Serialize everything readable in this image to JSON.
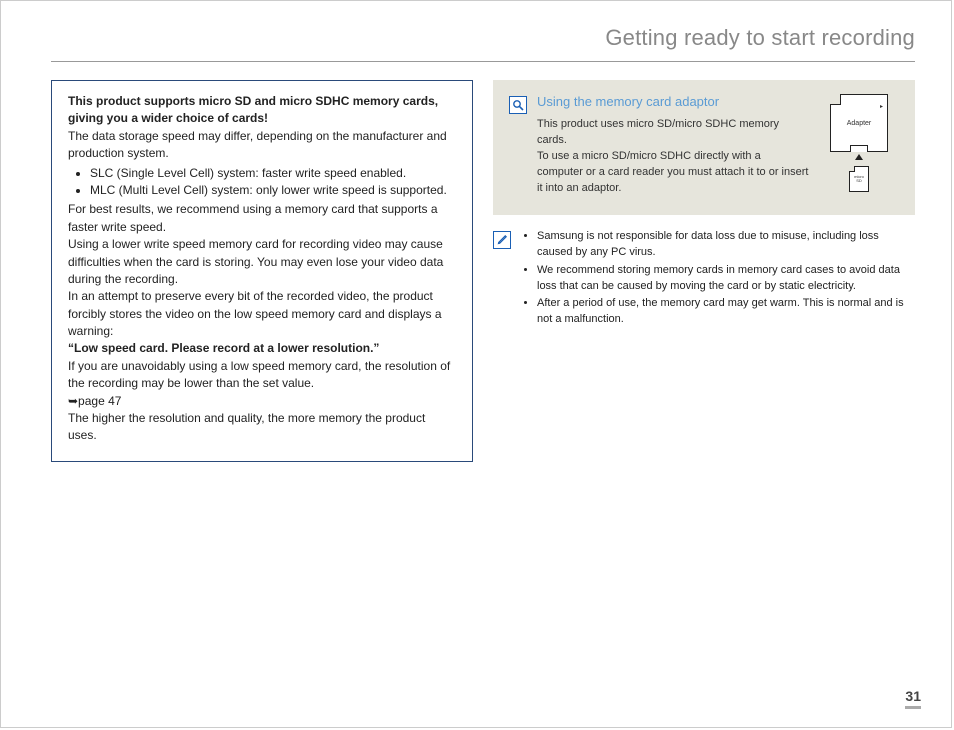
{
  "header": {
    "title": "Getting ready to start recording"
  },
  "left": {
    "lead_bold": "This product supports micro SD and micro SDHC memory cards, giving you a wider choice of cards!",
    "p1": "The data storage speed may differ, depending on the manufacturer and production system.",
    "bullets": [
      "SLC (Single Level Cell) system: faster write speed enabled.",
      "MLC (Multi Level Cell) system: only lower write speed is supported."
    ],
    "p2": "For best results, we recommend using a memory card that supports a faster write speed.",
    "p3": "Using a lower write speed memory card for recording video may cause difficulties when the card is storing. You may even lose your video data during the recording.",
    "p4": "In an attempt to preserve every bit of the recorded video, the product forcibly stores the video on the low speed memory card and displays a warning:",
    "warning": "“Low speed card. Please record at a lower resolution.”",
    "p5a": "If you are unavoidably using a low speed memory card, the resolution of the recording may be lower than the set value.",
    "page_ref": "➥page 47",
    "p6": "The higher the resolution and quality, the more memory the product uses."
  },
  "right": {
    "panel_title": "Using the memory card adaptor",
    "panel_body1": "This product uses micro SD/micro SDHC memory cards.",
    "panel_body2": "To use a micro SD/micro SDHC directly with a computer or a card reader you must attach it to or insert it into an adaptor.",
    "adapter_label": "Adapter",
    "notes": [
      "Samsung is not responsible for data loss due to misuse, including loss caused by any PC virus.",
      "We recommend storing memory cards in memory card cases to avoid data loss that can be caused by moving the card or by static electricity.",
      "After a period of use, the memory card may get warm. This is normal and is not a malfunction."
    ]
  },
  "page_number": "31"
}
